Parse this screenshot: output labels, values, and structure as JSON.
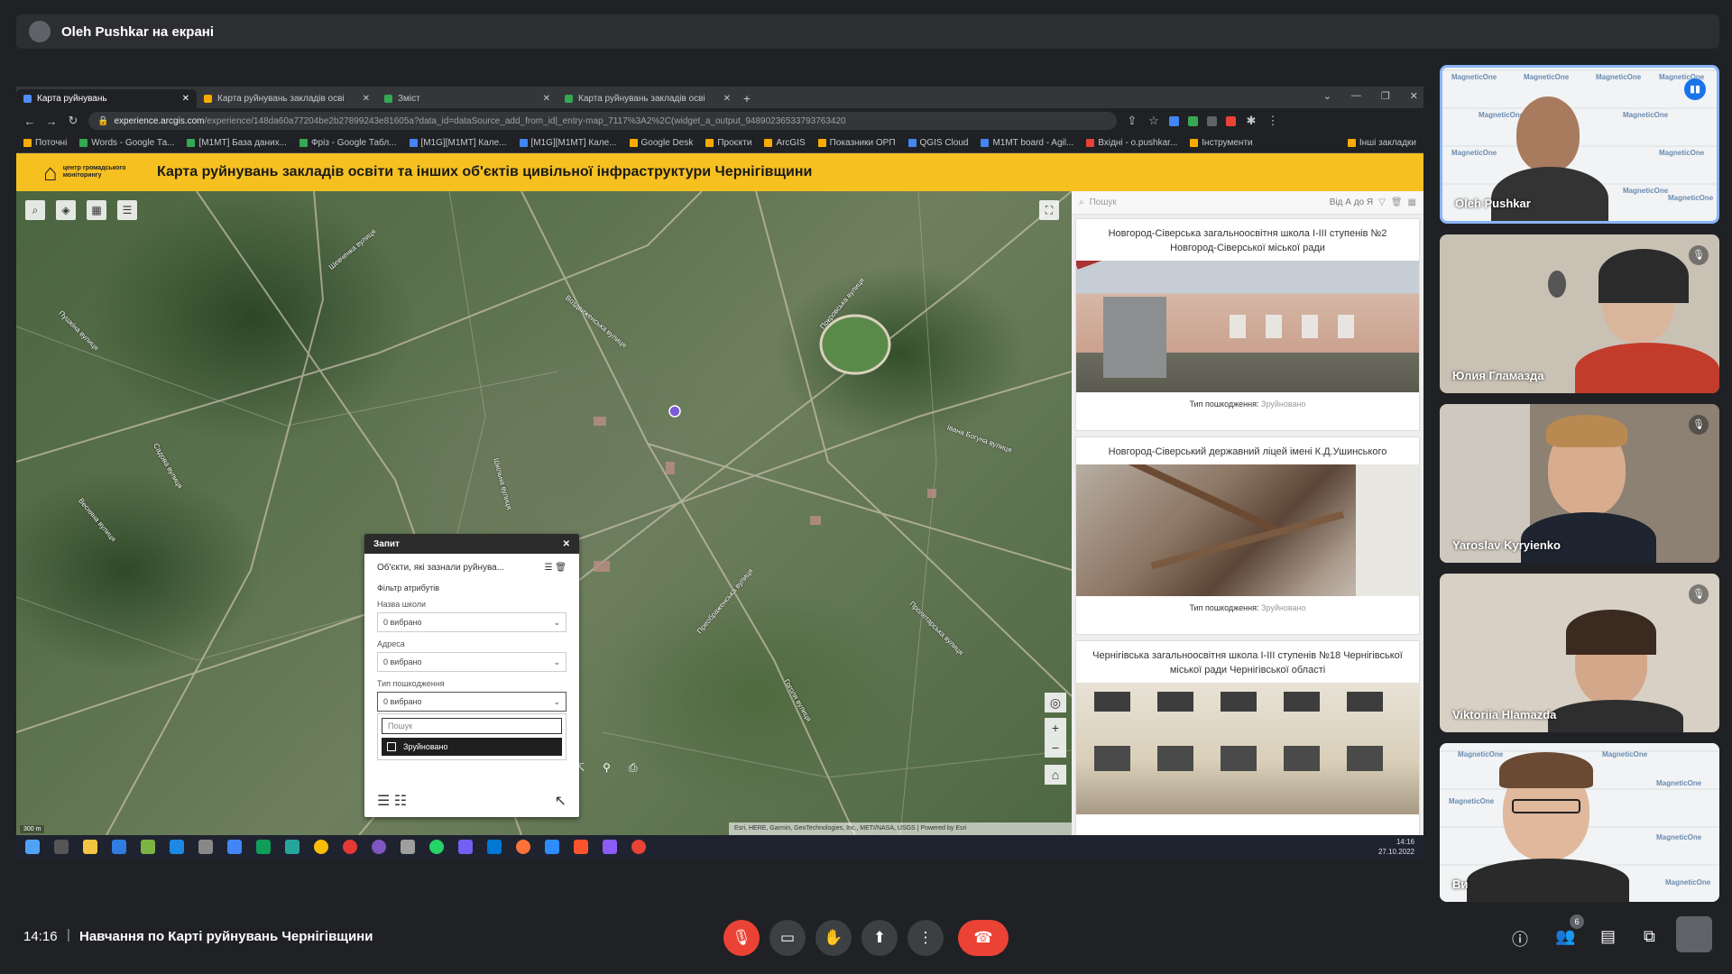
{
  "presenter": {
    "text": "Oleh Pushkar на екрані"
  },
  "browser": {
    "tabs": [
      {
        "label": "Карта руйнувань",
        "active": true
      },
      {
        "label": "Карта руйнувань закладів осві",
        "active": false
      },
      {
        "label": "Зміст",
        "active": false
      },
      {
        "label": "Карта руйнувань закладів осві",
        "active": false
      }
    ],
    "url_host": "experience.arcgis.com",
    "url_path": "/experience/148da60a77204be2b27899243e81605a?data_id=dataSource_add_from_id|_entry-map_7117%3A2%2C(widget_a_output_94890236533793763420",
    "bookmarks": [
      "Поточні",
      "Words - Google Та...",
      "[M1MT] База даних...",
      "Фріз - Google Табл...",
      "[M1G][M1MT] Кале...",
      "[M1G][M1MT] Кале...",
      "Google Desk",
      "Проєкти",
      "ArcGIS",
      "Показники ОРП",
      "QGIS Cloud",
      "M1MT board - Agil...",
      "Вхідні - o.pushkar...",
      "Інструменти",
      "Інші закладки"
    ]
  },
  "app": {
    "logo_text": "центр громадського моніторингу",
    "title": "Карта руйнувань закладів освіти та інших об'єктів цивільної інфраструктури Чернігівщини"
  },
  "map": {
    "road_labels": [
      "Шевченка вулиця",
      "Пушкіна вулиця",
      "Воздвиженська вулиця",
      "Покровська вулиця",
      "Преображенська вулиця",
      "Шкільна вулиця",
      "Івана Богуна вулиця",
      "Садова вулиця",
      "Пролетарська вулиця",
      "Гоголя вулиця",
      "Весняна вулиця"
    ],
    "attribution": "Esri, HERE, Garmin, GeoTechnologies, Inc., METI/NASA, USGS | Powered by Esri",
    "scale": "300 m"
  },
  "query": {
    "title": "Запит",
    "layer": "Об'єкти, які зазнали руйнува...",
    "filter_header": "Фільтр атрибутів",
    "fields": [
      {
        "label": "Назва школи",
        "value": "0 вибрано"
      },
      {
        "label": "Адреса",
        "value": "0 вибрано"
      },
      {
        "label": "Тип пошкодження",
        "value": "0 вибрано"
      }
    ],
    "search_placeholder": "Пошук",
    "option": "Зруйновано"
  },
  "list": {
    "search_placeholder": "Пошук",
    "sort_label": "Від А до Я",
    "type_label": "Тип пошкодження:",
    "cards": [
      {
        "title": "Новгород-Сіверська загальноосвітня школа І-ІІІ ступенів №2 Новгород-Сіверської міської ради",
        "type": "Зруйновано"
      },
      {
        "title": "Новгород-Сіверський державний ліцей імені К.Д.Ушинського",
        "type": "Зруйновано"
      },
      {
        "title": "Чернігівська загальноосвітня школа І-ІІІ ступенів №18 Чернігівської міської ради Чернігівської області",
        "type": ""
      }
    ]
  },
  "taskbar": {
    "time": "14:16",
    "date": "27.10.2022"
  },
  "participants": [
    {
      "name": "Oleh Pushkar",
      "speaking": true,
      "muted": false
    },
    {
      "name": "Юлия Гламазда",
      "speaking": false,
      "muted": true
    },
    {
      "name": "Yaroslav Kyryienko",
      "speaking": false,
      "muted": true
    },
    {
      "name": "Viktoriia Hlamazda",
      "speaking": false,
      "muted": true
    },
    {
      "name": "Ви",
      "speaking": false,
      "muted": false
    }
  ],
  "meeting": {
    "time": "14:16",
    "separator": "|",
    "title": "Навчання по Карті руйнувань Чернігівщини",
    "people_count": "6"
  },
  "colors": {
    "header_yellow": "#f6c021",
    "meet_red": "#ea4335",
    "meet_bg": "#202124",
    "speaking_blue": "#1a73e8"
  }
}
